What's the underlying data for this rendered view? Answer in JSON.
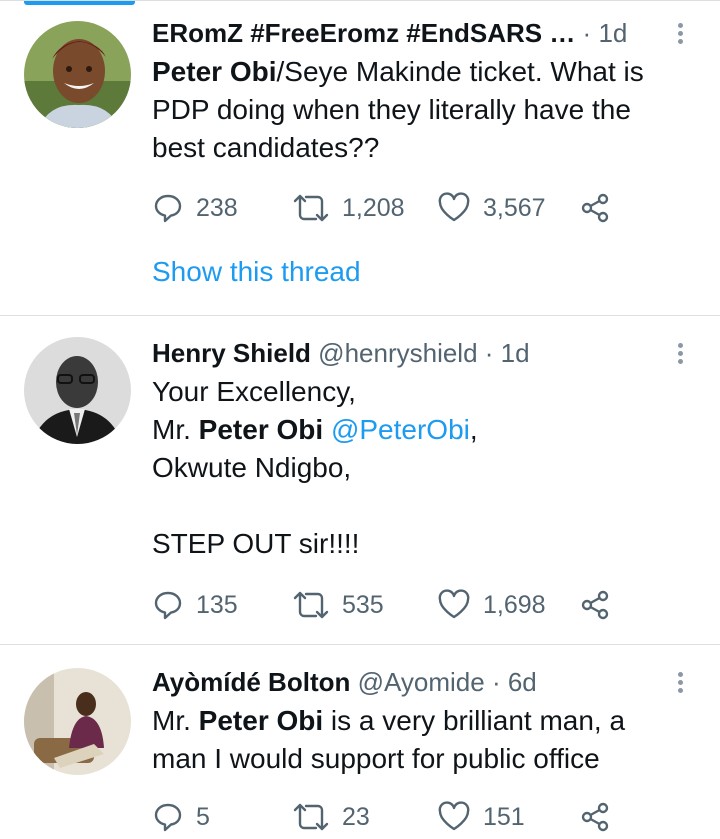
{
  "tweets": [
    {
      "name": "ERomZ #FreeEromz #EndSARS …",
      "handle": "",
      "time": "1d",
      "body": [
        {
          "t": "Peter Obi",
          "b": true
        },
        {
          "t": "/Seye Makinde ticket. What is PDP doing when they literally have the best candidates??"
        }
      ],
      "replies": "238",
      "retweets": "1,208",
      "likes": "3,567",
      "show_thread": "Show this thread"
    },
    {
      "name": "Henry Shield",
      "handle": "@henryshield",
      "time": "1d",
      "body": [
        {
          "t": "Your Excellency,\nMr. "
        },
        {
          "t": "Peter Obi",
          "b": true
        },
        {
          "t": " "
        },
        {
          "t": "@PeterObi",
          "m": true
        },
        {
          "t": ",\nOkwute Ndigbo,\n\nSTEP OUT sir!!!!"
        }
      ],
      "replies": "135",
      "retweets": "535",
      "likes": "1,698"
    },
    {
      "name": "Ayòmídé Bolton",
      "handle": "@Ayomide",
      "time": "6d",
      "body": [
        {
          "t": "Mr. "
        },
        {
          "t": "Peter Obi",
          "b": true
        },
        {
          "t": " is a very brilliant man, a man I would support for public office"
        }
      ],
      "replies": "5",
      "retweets": "23",
      "likes": "151"
    }
  ],
  "icons": {
    "reply": "reply-icon",
    "retweet": "retweet-icon",
    "like": "heart-icon",
    "share": "share-icon",
    "more": "more-vertical-icon"
  },
  "colors": {
    "accent": "#1d9bf0",
    "muted": "#536471",
    "separator": "#dcdfe2"
  }
}
